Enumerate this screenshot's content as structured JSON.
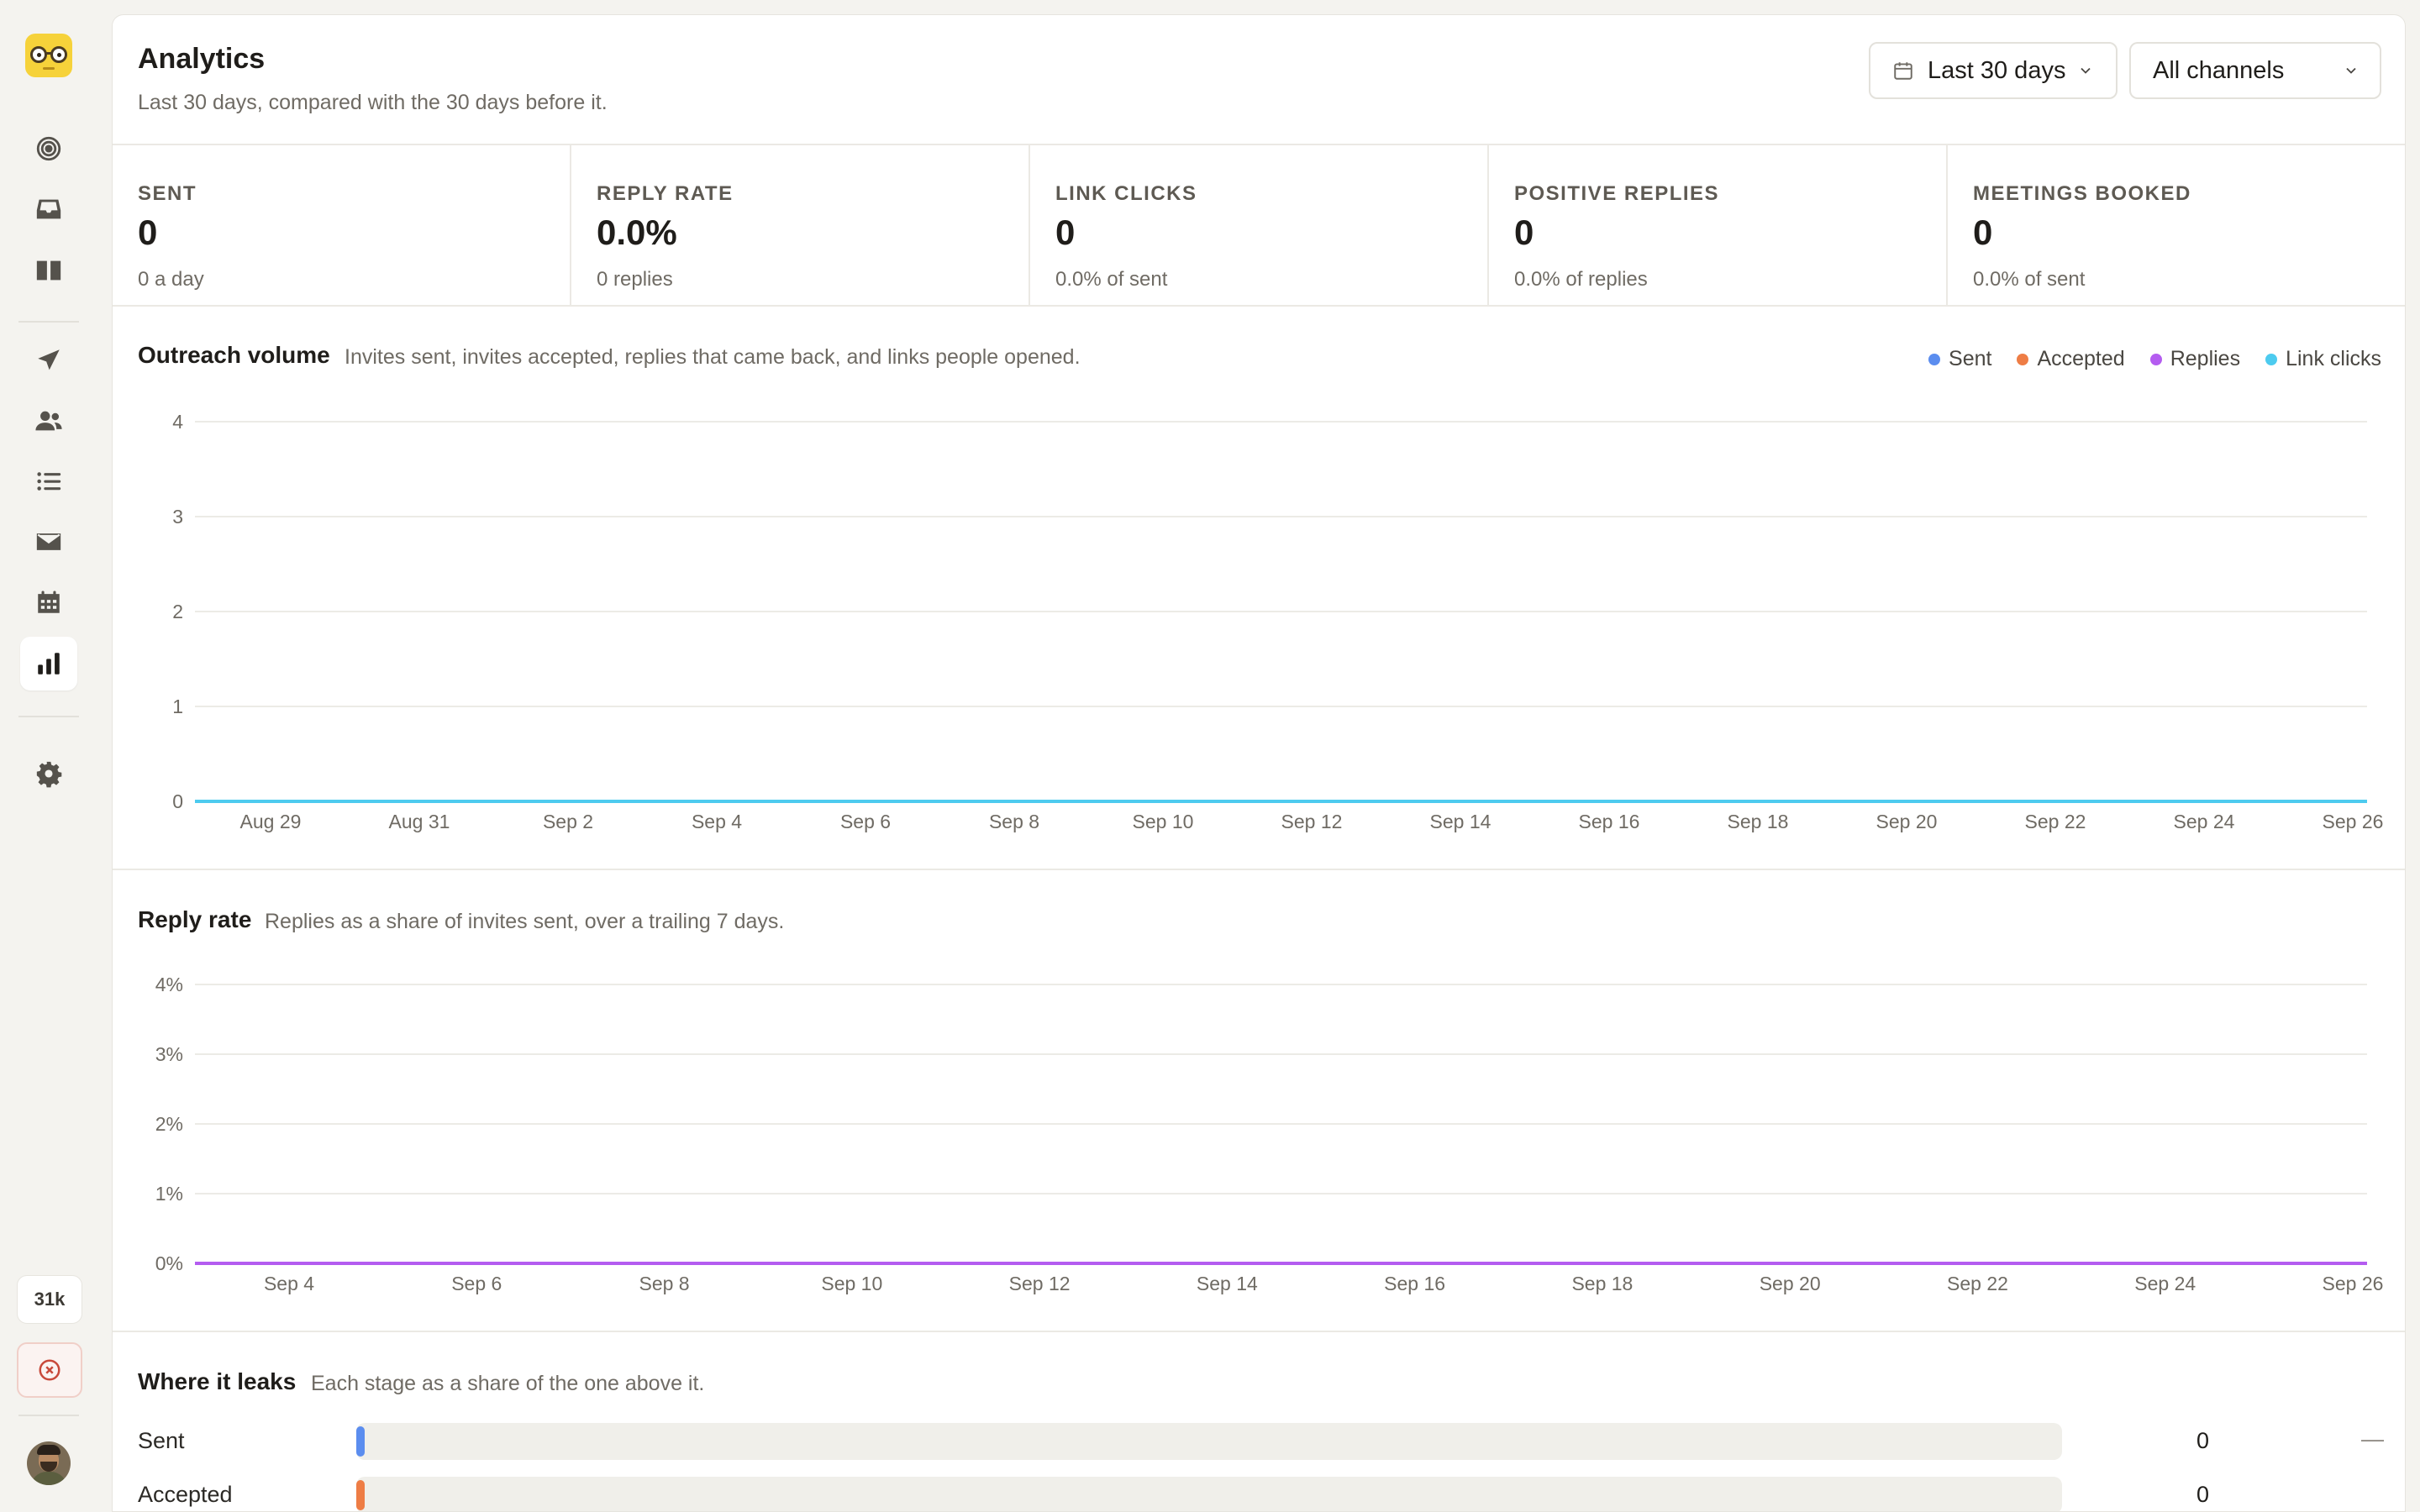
{
  "sidebar": {
    "items": [
      {
        "name": "target-icon",
        "active": false
      },
      {
        "name": "inbox-icon",
        "active": false
      },
      {
        "name": "book-icon",
        "active": false
      },
      {
        "name": "send-icon",
        "active": false
      },
      {
        "name": "users-icon",
        "active": false
      },
      {
        "name": "list-icon",
        "active": false
      },
      {
        "name": "mail-icon",
        "active": false
      },
      {
        "name": "calendar-icon",
        "active": false
      },
      {
        "name": "bar-chart-icon",
        "active": true
      },
      {
        "name": "gear-icon",
        "active": false
      }
    ],
    "credits": "31k"
  },
  "header": {
    "title": "Analytics",
    "subtitle": "Last 30 days, compared with the 30 days before it.",
    "range_select": "Last 30 days",
    "channel_select": "All channels"
  },
  "kpis": [
    {
      "label": "SENT",
      "value": "0",
      "sub": "0 a day"
    },
    {
      "label": "REPLY RATE",
      "value": "0.0%",
      "sub": "0 replies"
    },
    {
      "label": "LINK CLICKS",
      "value": "0",
      "sub": "0.0% of sent"
    },
    {
      "label": "POSITIVE REPLIES",
      "value": "0",
      "sub": "0.0% of replies"
    },
    {
      "label": "MEETINGS BOOKED",
      "value": "0",
      "sub": "0.0% of sent"
    }
  ],
  "outreach": {
    "title": "Outreach volume",
    "desc": "Invites sent, invites accepted, replies that came back, and links people opened.",
    "legend": [
      {
        "label": "Sent",
        "color": "#5b8def"
      },
      {
        "label": "Accepted",
        "color": "#ee7d45"
      },
      {
        "label": "Replies",
        "color": "#b45cf0"
      },
      {
        "label": "Link clicks",
        "color": "#4dcbef"
      }
    ]
  },
  "reply_rate": {
    "title": "Reply rate",
    "desc": "Replies as a share of invites sent, over a trailing 7 days."
  },
  "leaks": {
    "title": "Where it leaks",
    "desc": "Each stage as a share of the one above it.",
    "rows": [
      {
        "label": "Sent",
        "value": "0",
        "pct": "—",
        "color": "#5b8def"
      },
      {
        "label": "Accepted",
        "value": "0",
        "pct": "",
        "color": "#ee7d45"
      }
    ]
  },
  "chart_data": [
    {
      "type": "line",
      "title": "Outreach volume",
      "x_ticks": [
        "Aug 29",
        "Aug 31",
        "Sep 2",
        "Sep 4",
        "Sep 6",
        "Sep 8",
        "Sep 10",
        "Sep 12",
        "Sep 14",
        "Sep 16",
        "Sep 18",
        "Sep 20",
        "Sep 22",
        "Sep 24",
        "Sep 26"
      ],
      "y_ticks": [
        "0",
        "1",
        "2",
        "3",
        "4"
      ],
      "ylim": [
        0,
        4
      ],
      "series": [
        {
          "name": "Sent",
          "values": [
            0,
            0,
            0,
            0,
            0,
            0,
            0,
            0,
            0,
            0,
            0,
            0,
            0,
            0,
            0
          ]
        },
        {
          "name": "Accepted",
          "values": [
            0,
            0,
            0,
            0,
            0,
            0,
            0,
            0,
            0,
            0,
            0,
            0,
            0,
            0,
            0
          ]
        },
        {
          "name": "Replies",
          "values": [
            0,
            0,
            0,
            0,
            0,
            0,
            0,
            0,
            0,
            0,
            0,
            0,
            0,
            0,
            0
          ]
        },
        {
          "name": "Link clicks",
          "values": [
            0,
            0,
            0,
            0,
            0,
            0,
            0,
            0,
            0,
            0,
            0,
            0,
            0,
            0,
            0
          ]
        }
      ],
      "grid": true,
      "legend": "top-right"
    },
    {
      "type": "line",
      "title": "Reply rate",
      "x_ticks": [
        "Sep 4",
        "Sep 6",
        "Sep 8",
        "Sep 10",
        "Sep 12",
        "Sep 14",
        "Sep 16",
        "Sep 18",
        "Sep 20",
        "Sep 22",
        "Sep 24",
        "Sep 26"
      ],
      "y_ticks": [
        "0%",
        "1%",
        "2%",
        "3%",
        "4%"
      ],
      "ylim": [
        0,
        4
      ],
      "series": [
        {
          "name": "Reply rate",
          "values": [
            0,
            0,
            0,
            0,
            0,
            0,
            0,
            0,
            0,
            0,
            0,
            0
          ]
        }
      ],
      "grid": true
    }
  ]
}
